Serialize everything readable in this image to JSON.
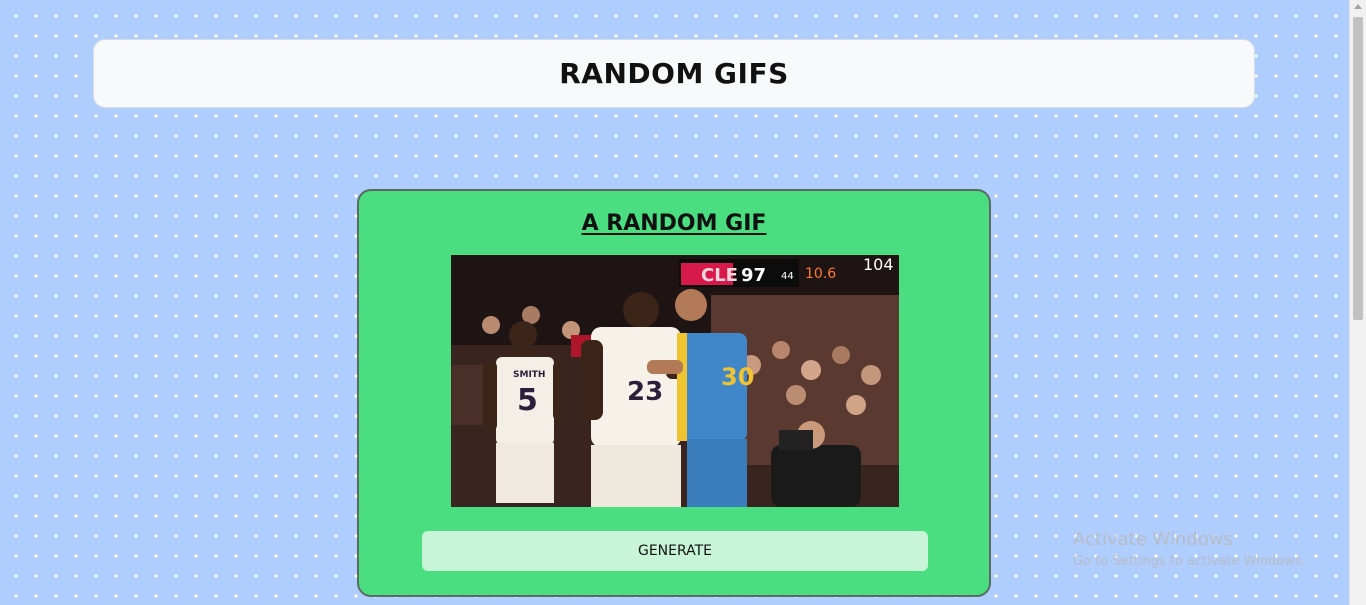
{
  "header": {
    "title": "RANDOM GIFS"
  },
  "card": {
    "title": "A RANDOM GIF",
    "gif": {
      "scoreboard_team": "CLE",
      "scoreboard_score": "97",
      "scoreboard_small": "44",
      "scoreboard_clock": "10.6",
      "scoreboard_other": "104",
      "jersey_name": "SMITH",
      "jersey_number": "5",
      "jersey_number_2": "23",
      "jersey_number_3": "30"
    },
    "generate_label": "GENERATE"
  },
  "watermark": {
    "title": "Activate Windows",
    "subtitle": "Go to Settings to activate Windows."
  },
  "colors": {
    "page_bg": "#afcdfd",
    "card_bg": "#4ade80",
    "button_bg": "#c8f5d8",
    "header_bg": "#f8f9fb"
  }
}
